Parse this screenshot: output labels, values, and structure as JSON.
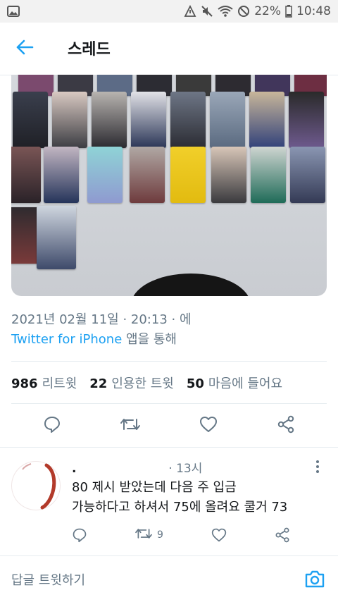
{
  "status_bar": {
    "battery_percent": "22%",
    "time": "10:48"
  },
  "header": {
    "title": "스레드"
  },
  "tweet": {
    "date": "2021년 02월 11일 · 20:13 · 에",
    "source_link": "Twitter for iPhone",
    "source_suffix": " 앱을 통해",
    "stats": {
      "retweets_count": "986",
      "retweets_label": "리트윗",
      "quotes_count": "22",
      "quotes_label": "인용한 트윗",
      "likes_count": "50",
      "likes_label": "마음에 들어요"
    }
  },
  "reply": {
    "name": ".",
    "time": "· 13시",
    "text_line1": "80 제시 받았는데 다음 주 입금",
    "text_line2": "가능하다고 하셔서 75에 올려요 쿨거 73",
    "retweet_count": "9"
  },
  "composer": {
    "placeholder": "답글 트윗하기"
  },
  "colors": {
    "accent": "#1da1f2",
    "muted": "#657786"
  },
  "icons": [
    "gallery-icon",
    "no-data-icon",
    "mute-icon",
    "wifi-icon",
    "no-sim-icon",
    "battery-icon",
    "back-arrow-icon",
    "reply-icon",
    "retweet-icon",
    "like-icon",
    "share-icon",
    "more-icon",
    "camera-icon"
  ]
}
